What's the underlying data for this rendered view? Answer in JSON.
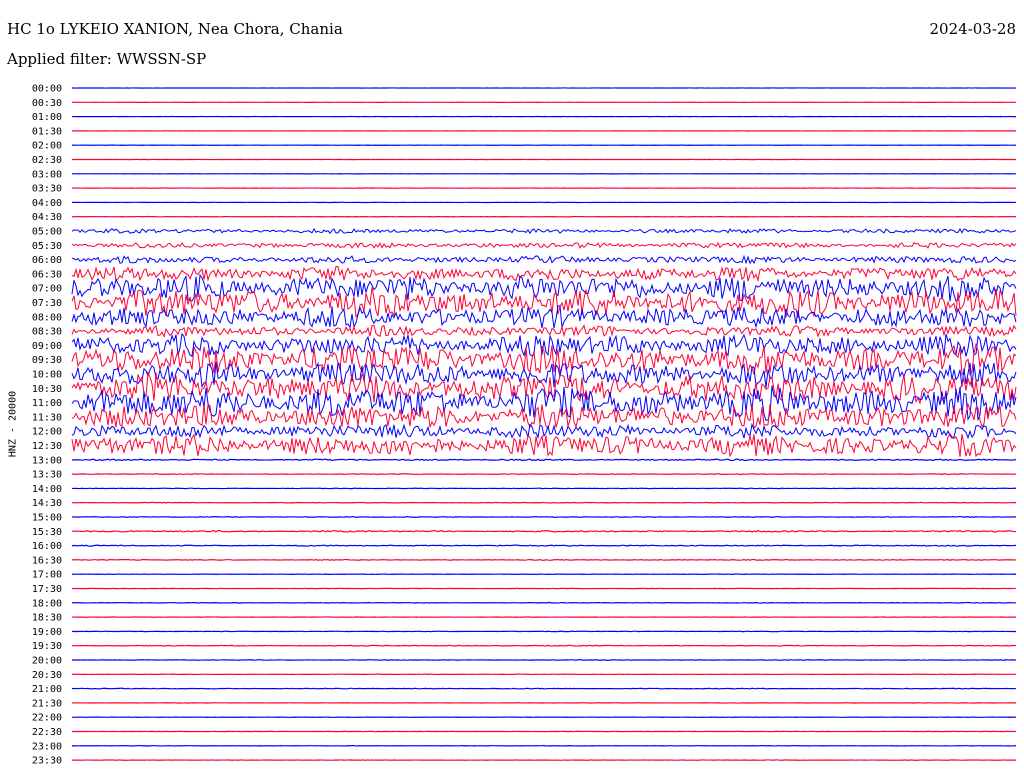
{
  "header": {
    "title": "HC 1o LYKEIO XANION, Nea Chora, Chania",
    "date": "2024-03-28",
    "filter": "Applied filter: WWSSN-SP"
  },
  "chart_data": {
    "type": "line",
    "ylabel": "HNZ - 20000",
    "colors": {
      "even": "#0000ff",
      "odd": "#ff0033"
    },
    "rows": [
      {
        "label": "00:00",
        "activity": 0.1
      },
      {
        "label": "00:30",
        "activity": 0.1
      },
      {
        "label": "01:00",
        "activity": 0.15
      },
      {
        "label": "01:30",
        "activity": 0.1
      },
      {
        "label": "02:00",
        "activity": 0.1
      },
      {
        "label": "02:30",
        "activity": 0.15
      },
      {
        "label": "03:00",
        "activity": 0.1
      },
      {
        "label": "03:30",
        "activity": 0.15
      },
      {
        "label": "04:00",
        "activity": 0.15
      },
      {
        "label": "04:30",
        "activity": 0.2
      },
      {
        "label": "05:00",
        "activity": 2.5
      },
      {
        "label": "05:30",
        "activity": 3
      },
      {
        "label": "06:00",
        "activity": 4
      },
      {
        "label": "06:30",
        "activity": 8
      },
      {
        "label": "07:00",
        "activity": 14
      },
      {
        "label": "07:30",
        "activity": 16
      },
      {
        "label": "08:00",
        "activity": 12
      },
      {
        "label": "08:30",
        "activity": 6
      },
      {
        "label": "09:00",
        "activity": 12
      },
      {
        "label": "09:30",
        "activity": 16
      },
      {
        "label": "10:00",
        "activity": 14
      },
      {
        "label": "10:30",
        "activity": 16
      },
      {
        "label": "11:00",
        "activity": 18
      },
      {
        "label": "11:30",
        "activity": 14
      },
      {
        "label": "12:00",
        "activity": 8
      },
      {
        "label": "12:30",
        "activity": 12
      },
      {
        "label": "13:00",
        "activity": 0.8
      },
      {
        "label": "13:30",
        "activity": 0.4
      },
      {
        "label": "14:00",
        "activity": 0.3
      },
      {
        "label": "14:30",
        "activity": 0.3
      },
      {
        "label": "15:00",
        "activity": 0.4
      },
      {
        "label": "15:30",
        "activity": 0.8
      },
      {
        "label": "16:00",
        "activity": 0.6
      },
      {
        "label": "16:30",
        "activity": 0.4
      },
      {
        "label": "17:00",
        "activity": 0.2
      },
      {
        "label": "17:30",
        "activity": 0.2
      },
      {
        "label": "18:00",
        "activity": 0.3
      },
      {
        "label": "18:30",
        "activity": 0.2
      },
      {
        "label": "19:00",
        "activity": 0.3
      },
      {
        "label": "19:30",
        "activity": 0.4
      },
      {
        "label": "20:00",
        "activity": 0.3
      },
      {
        "label": "20:30",
        "activity": 0.2
      },
      {
        "label": "21:00",
        "activity": 0.4
      },
      {
        "label": "21:30",
        "activity": 0.2
      },
      {
        "label": "22:00",
        "activity": 0.2
      },
      {
        "label": "22:30",
        "activity": 0.2
      },
      {
        "label": "23:00",
        "activity": 0.2
      },
      {
        "label": "23:30",
        "activity": 0.2
      }
    ]
  }
}
